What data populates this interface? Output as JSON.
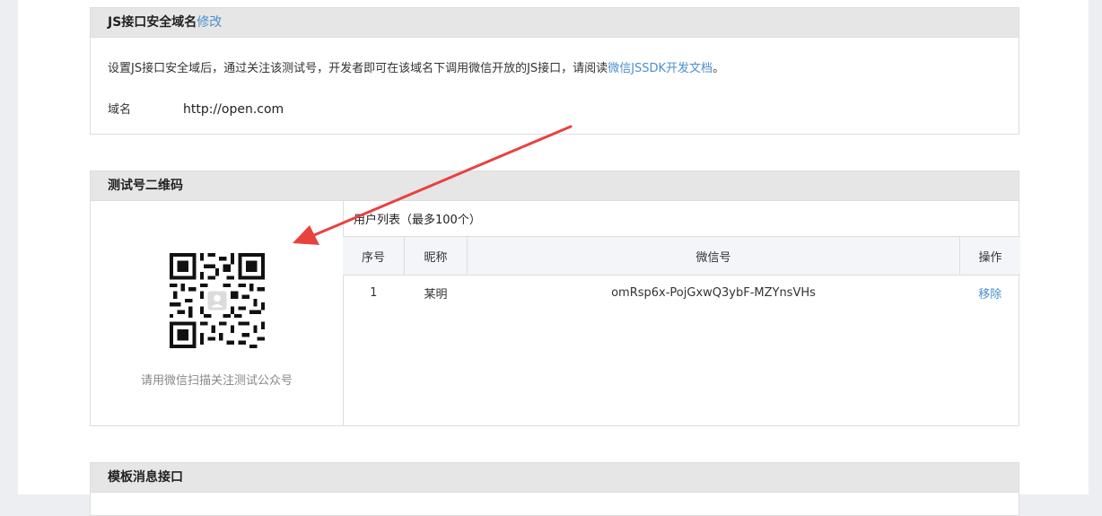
{
  "js_domain": {
    "title": "JS接口安全域名",
    "edit_label": "修改",
    "desc_prefix": "设置JS接口安全域后，通过关注该测试号，开发者即可在该域名下调用微信开放的JS接口，请阅读",
    "desc_link": "微信JSSDK开发文档",
    "desc_suffix": "。",
    "domain_label": "域名",
    "domain_value": "http://open.com"
  },
  "qrcode_panel": {
    "title": "测试号二维码",
    "caption": "请用微信扫描关注测试公众号",
    "user_list_title": "用户列表（最多100个）",
    "columns": [
      "序号",
      "昵称",
      "微信号",
      "操作"
    ],
    "rows": [
      {
        "index": "1",
        "nickname": "某明",
        "wechat_id": "omRsp6x-PojGxwQ3ybF-MZYnsVHs",
        "action": "移除"
      }
    ]
  },
  "template_panel": {
    "title": "模板消息接口"
  },
  "colors": {
    "link": "#4a8fd1",
    "arrow": "#e8423f"
  }
}
